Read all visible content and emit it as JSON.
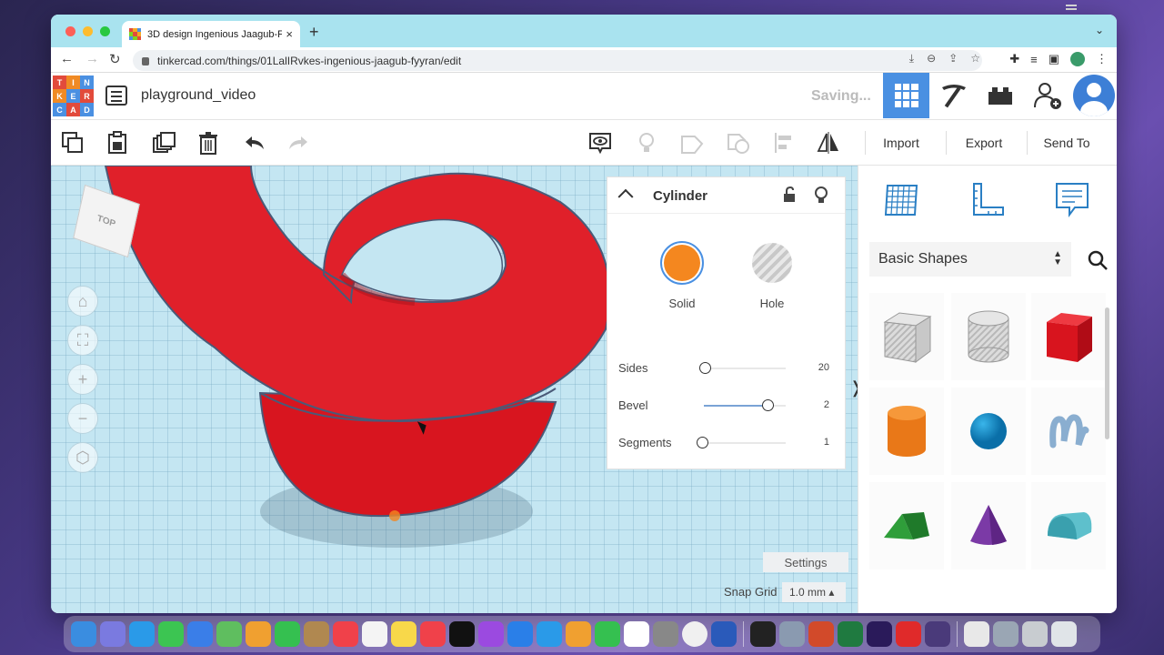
{
  "browser": {
    "tab_title": "3D design Ingenious Jaagub-F",
    "tab_close": "×",
    "new_tab": "+",
    "url": "tinkercad.com/things/01LalIRvkes-ingenious-jaagub-fyyran/edit"
  },
  "header": {
    "logo_letters": [
      "T",
      "I",
      "N",
      "K",
      "E",
      "R",
      "C",
      "A",
      "D"
    ],
    "project_name": "playground_video",
    "status": "Saving..."
  },
  "toolbar": {
    "import_label": "Import",
    "export_label": "Export",
    "send_to_label": "Send To"
  },
  "viewcube": {
    "face_label": "TOP"
  },
  "inspector": {
    "title": "Cylinder",
    "solid_label": "Solid",
    "hole_label": "Hole",
    "solid_color": "#f4871f",
    "properties": [
      {
        "label": "Sides",
        "value": "20",
        "fraction": 0.1
      },
      {
        "label": "Bevel",
        "value": "2",
        "fraction": 0.76
      },
      {
        "label": "Segments",
        "value": "1",
        "fraction": 0.0
      }
    ]
  },
  "workplane": {
    "settings_label": "Settings",
    "snap_label": "Snap Grid",
    "snap_value": "1.0 mm ▴"
  },
  "shapes_panel": {
    "category": "Basic Shapes",
    "shapes": [
      "box-hole",
      "cylinder-hole",
      "box",
      "cylinder",
      "sphere",
      "scribble",
      "roof",
      "cone",
      "round-roof"
    ]
  },
  "colors": {
    "accent": "#4a90e2",
    "tab_strip": "#a9e3ef",
    "workplane": "#c4e6f2",
    "object_red": "#e0202a"
  }
}
